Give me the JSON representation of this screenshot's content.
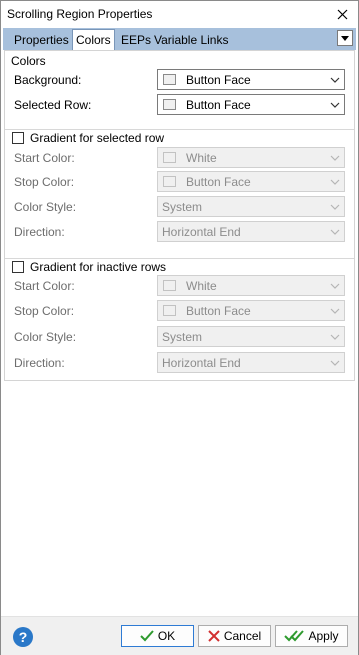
{
  "window": {
    "title": "Scrolling Region Properties"
  },
  "tabs": [
    {
      "label": "Properties",
      "active": false
    },
    {
      "label": "Colors",
      "active": true
    },
    {
      "label": "EEPs",
      "active": false
    },
    {
      "label": "Variable Links",
      "active": false
    }
  ],
  "colors_group": {
    "title": "Colors",
    "background_label": "Background:",
    "background_value": "Button Face",
    "selected_row_label": "Selected Row:",
    "selected_row_value": "Button Face"
  },
  "gradient_selected": {
    "checkbox_label": "Gradient for selected row",
    "checked": false,
    "start_color_label": "Start Color:",
    "start_color_value": "White",
    "stop_color_label": "Stop Color:",
    "stop_color_value": "Button Face",
    "color_style_label": "Color Style:",
    "color_style_value": "System",
    "direction_label": "Direction:",
    "direction_value": "Horizontal End"
  },
  "gradient_inactive": {
    "checkbox_label": "Gradient for inactive rows",
    "checked": false,
    "start_color_label": "Start Color:",
    "start_color_value": "White",
    "stop_color_label": "Stop Color:",
    "stop_color_value": "Button Face",
    "color_style_label": "Color Style:",
    "color_style_value": "System",
    "direction_label": "Direction:",
    "direction_value": "Horizontal End"
  },
  "footer": {
    "help_icon": "?",
    "ok_label": "OK",
    "cancel_label": "Cancel",
    "apply_label": "Apply"
  },
  "theme": {
    "tabstrip_bg": "#a7c0dc",
    "help_blue": "#2a78c8",
    "ok_check_green": "#2e9a2e",
    "cancel_red": "#d23030"
  }
}
